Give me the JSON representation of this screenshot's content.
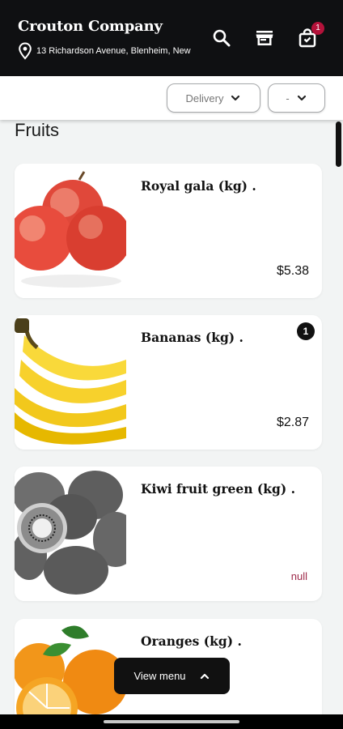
{
  "header": {
    "title": "Crouton Company",
    "address": "13 Richardson Avenue, Blenheim, New",
    "cart_count": "1",
    "icons": [
      "location-pin-icon",
      "search-icon",
      "store-icon",
      "shopping-bag-icon"
    ]
  },
  "filters": {
    "fulfilment": "Delivery",
    "second": "-"
  },
  "section_title": "Fruits",
  "products": [
    {
      "name": "Royal gala (kg) .",
      "price": "$5.38",
      "qty": ""
    },
    {
      "name": "Bananas (kg) .",
      "price": "$2.87",
      "qty": "1"
    },
    {
      "name": "Kiwi fruit green (kg) .",
      "price": "null",
      "qty": ""
    },
    {
      "name": "Oranges (kg) .",
      "price": "",
      "qty": ""
    }
  ],
  "view_menu_label": "View menu",
  "colors": {
    "header_bg": "#0f1012",
    "badge": "#b3123a",
    "null_text": "#9e2a4a"
  }
}
